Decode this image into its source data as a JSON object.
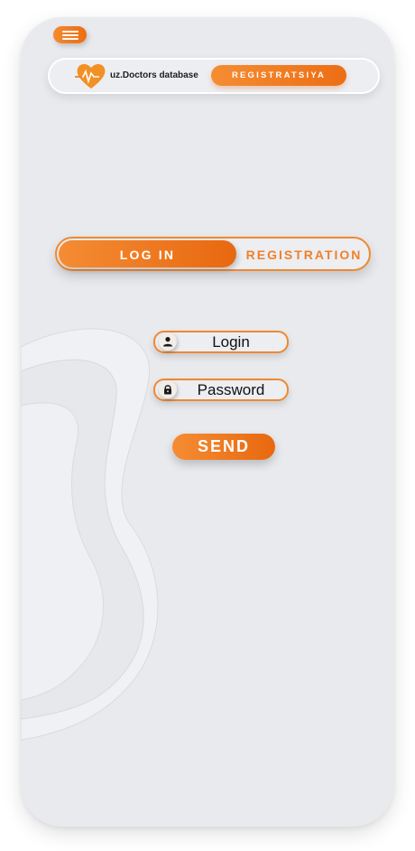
{
  "app": {
    "brand_name": "uz.Doctors database",
    "logo_icon": "heart-pulse-icon",
    "menu_icon": "hamburger-menu-icon"
  },
  "header": {
    "register_button_label": "REGISTRATSIYA"
  },
  "tabs": [
    {
      "label": "LOG IN",
      "active": true
    },
    {
      "label": "REGISTRATION",
      "active": false
    }
  ],
  "form": {
    "login_label": "Login",
    "login_icon": "user-icon",
    "password_label": "Password",
    "password_icon": "lock-icon",
    "submit_label": "SEND"
  },
  "colors": {
    "accent": "#F07F26",
    "accent_dark": "#E8680F",
    "background": "#E9EAEE"
  }
}
